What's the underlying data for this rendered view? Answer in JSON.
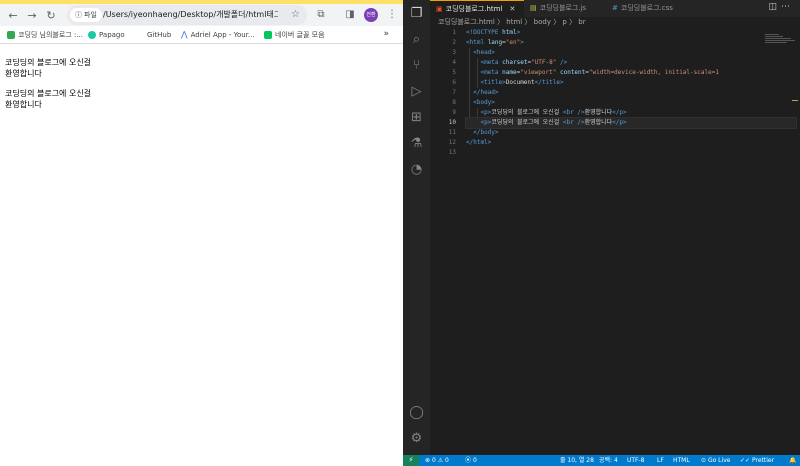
{
  "browser": {
    "nav": {
      "back_icon": "arrow-left-icon",
      "forward_icon": "arrow-right-icon",
      "reload_icon": "reload-icon"
    },
    "omnibox": {
      "chip_label": "파일",
      "url": "/Users/iyeonhaeng/Desktop/개발폴더/html태그적..."
    },
    "profile_label": "전환",
    "bookmarks": [
      {
        "label": "코딩딩 님의블로그 :...",
        "color": "#34a853"
      },
      {
        "label": "Papago",
        "color": "#1ec8a5"
      },
      {
        "label": "GitHub",
        "color": "#ffffff"
      },
      {
        "label": "Adriel App - Your...",
        "color": "#3b5bdb"
      },
      {
        "label": "네이버 글꼴 모음",
        "color": "#03c75a"
      }
    ],
    "page": {
      "paragraphs": [
        {
          "line1": "코딩딩의 블로그에 오신걸",
          "line2": "환영합니다"
        },
        {
          "line1": "코딩딩의 블로그에 오신걸",
          "line2": "환영합니다"
        }
      ]
    }
  },
  "vscode": {
    "tabs": [
      {
        "label": "코딩딩블로그.html",
        "icon_color": "#e44d26",
        "active": true
      },
      {
        "label": "코딩딩블로그.js",
        "icon_color": "#cbcb41",
        "active": false
      },
      {
        "label": "코딩딩블로그.css",
        "icon_color": "#519aba",
        "active": false
      }
    ],
    "breadcrumb": "코딩딩블로그.html 〉 html 〉 body 〉 p 〉 br",
    "current_line": 10,
    "status": {
      "errors": "0",
      "warnings": "0",
      "ports": "0",
      "cursor": "줄 10, 열 28",
      "spaces": "공백: 4",
      "encoding": "UTF-8",
      "eol": "LF",
      "language": "HTML",
      "golive": "Go Live",
      "prettier": "Prettier"
    }
  }
}
